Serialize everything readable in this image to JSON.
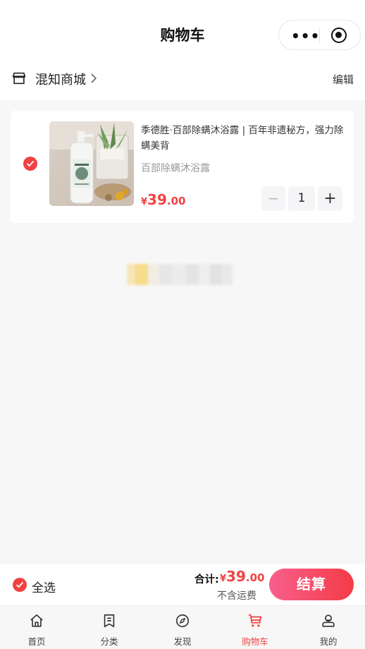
{
  "header": {
    "title": "购物车"
  },
  "capsule": {
    "more_icon": "more-dots-icon",
    "close_icon": "target-icon"
  },
  "store": {
    "name": "混知商城",
    "edit_label": "编辑",
    "icon": "store-icon"
  },
  "cart_items": [
    {
      "selected": true,
      "title": "季德胜·百部除螨沐浴露 | 百年非遗秘方，强力除螨美背",
      "spec": "百部除螨沐浴露",
      "price_symbol": "¥",
      "price_int": "39",
      "price_dec": ".00",
      "quantity": "1",
      "minus_label": "−",
      "plus_label": "+"
    }
  ],
  "checkout": {
    "select_all_label": "全选",
    "total_label": "合计:",
    "total_symbol": "¥",
    "total_int": "39",
    "total_dec": ".00",
    "shipping_note": "不含运费",
    "checkout_label": "结算"
  },
  "tabbar": {
    "tabs": [
      {
        "label": "首页",
        "icon": "home-icon"
      },
      {
        "label": "分类",
        "icon": "category-icon"
      },
      {
        "label": "发现",
        "icon": "compass-icon"
      },
      {
        "label": "购物车",
        "icon": "cart-icon",
        "active": true
      },
      {
        "label": "我的",
        "icon": "profile-icon"
      }
    ]
  },
  "colors": {
    "accent": "#f14242",
    "checkout_gradient_start": "#f85f8c",
    "checkout_gradient_end": "#f43b47",
    "background": "#f7f7f7"
  }
}
